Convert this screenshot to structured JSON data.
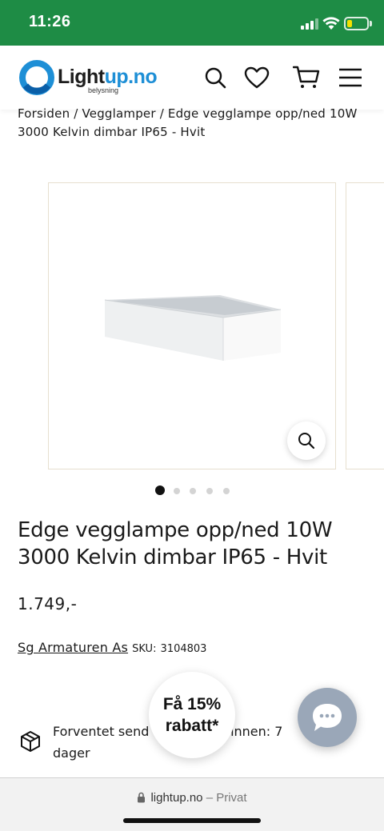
{
  "status_bar": {
    "time": "11:26",
    "bg_color": "#1e8c45",
    "battery_color": "#f5e000"
  },
  "header": {
    "logo": {
      "text_dark": "Light",
      "text_blue": "up.no",
      "subtitle": "belysning",
      "brand_color": "#1e8fd6"
    },
    "icons": [
      "search-icon",
      "heart-icon",
      "cart-icon",
      "menu-icon"
    ]
  },
  "breadcrumb": "Forsiden / Vegglamper / Edge vegglampe opp/ned 10W 3000 Kelvin dimbar IP65 - Hvit",
  "gallery": {
    "dot_count": 5,
    "active_index": 0
  },
  "product": {
    "title": "Edge vegglampe opp/ned 10W 3000 Kelvin dimbar IP65 - Hvit",
    "price": "1.749,-",
    "vendor": "Sg Armaturen As",
    "sku_label": "SKU:",
    "sku": "3104803"
  },
  "delivery": {
    "text": "Forventet sendes innen: 7 dager",
    "text_visible_start": "Forventet send",
    "text_visible_mid": "ger innen: 7",
    "text_visible_end": "dager"
  },
  "discount": {
    "line1": "Få 15%",
    "line2": "rabatt*"
  },
  "browser": {
    "url": "lightup.no",
    "mode": "– Privat"
  }
}
